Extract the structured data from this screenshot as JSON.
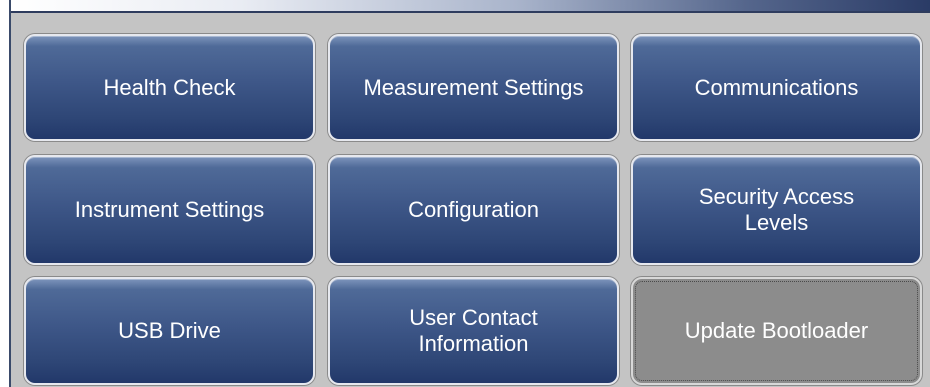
{
  "menu": {
    "buttons": [
      {
        "label": "Health Check"
      },
      {
        "label": "Measurement Settings"
      },
      {
        "label": "Communications"
      },
      {
        "label": "Instrument Settings"
      },
      {
        "label": "Configuration"
      },
      {
        "label": "Security Access\nLevels"
      },
      {
        "label": "USB Drive"
      },
      {
        "label": "User Contact\nInformation"
      },
      {
        "label": "Update Bootloader",
        "state": "disabled"
      }
    ]
  },
  "colors": {
    "button_blue": "#3e5788",
    "button_disabled": "#8c8c8c",
    "background": "#c4c4c4"
  }
}
